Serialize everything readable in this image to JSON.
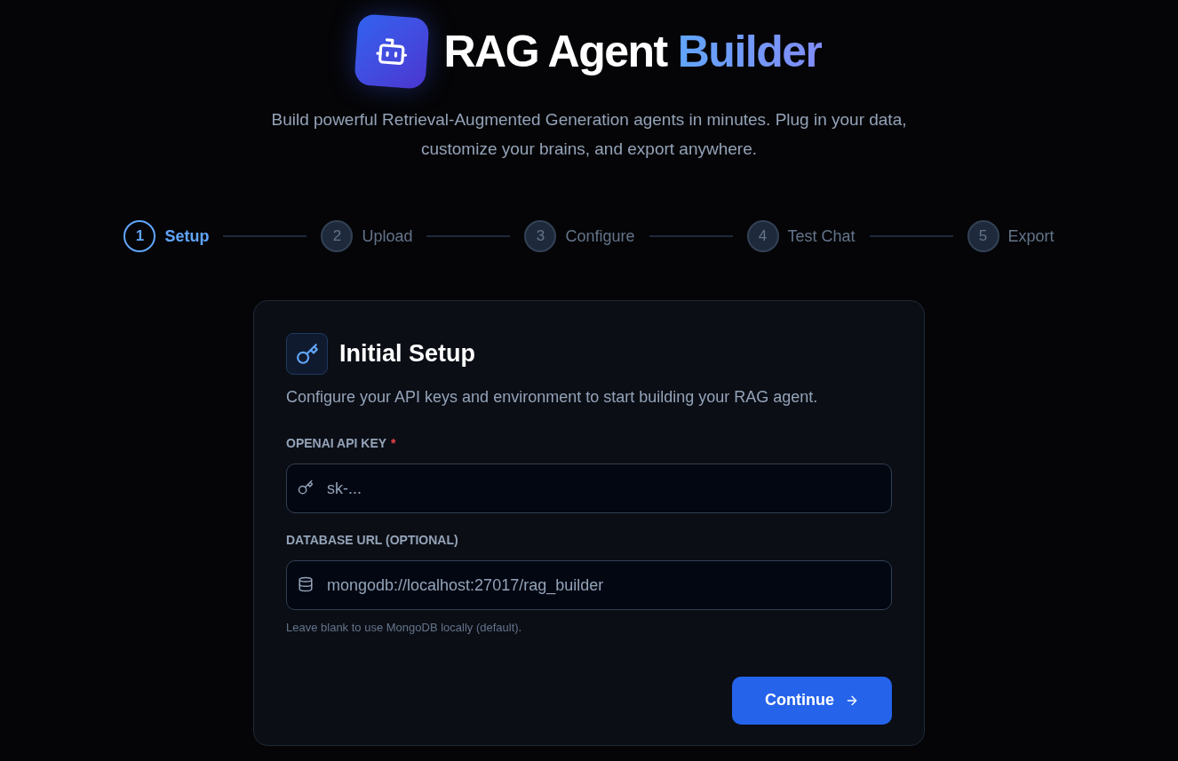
{
  "header": {
    "title": "RAG Agent",
    "title_accent": "Builder",
    "subtitle": "Build powerful Retrieval-Augmented Generation agents in minutes. Plug in your data, customize your brains, and export anywhere."
  },
  "steps": [
    {
      "number": "1",
      "label": "Setup",
      "selected": true
    },
    {
      "number": "2",
      "label": "Upload",
      "selected": false
    },
    {
      "number": "3",
      "label": "Configure",
      "selected": false
    },
    {
      "number": "4",
      "label": "Test Chat",
      "selected": false
    },
    {
      "number": "5",
      "label": "Export",
      "selected": false
    }
  ],
  "card": {
    "title": "Initial Setup",
    "description": "Configure your API keys and environment to start building your RAG agent.",
    "fields": [
      {
        "kind": "key",
        "label": "OPENAI API KEY",
        "required_mark": "*",
        "placeholder": "sk-..."
      },
      {
        "kind": "database",
        "label": "DATABASE URL (OPTIONAL)",
        "placeholder": "mongodb://localhost:27017/rag_builder",
        "hint": "Leave blank to use MongoDB locally (default)."
      }
    ],
    "button": "Continue"
  }
}
